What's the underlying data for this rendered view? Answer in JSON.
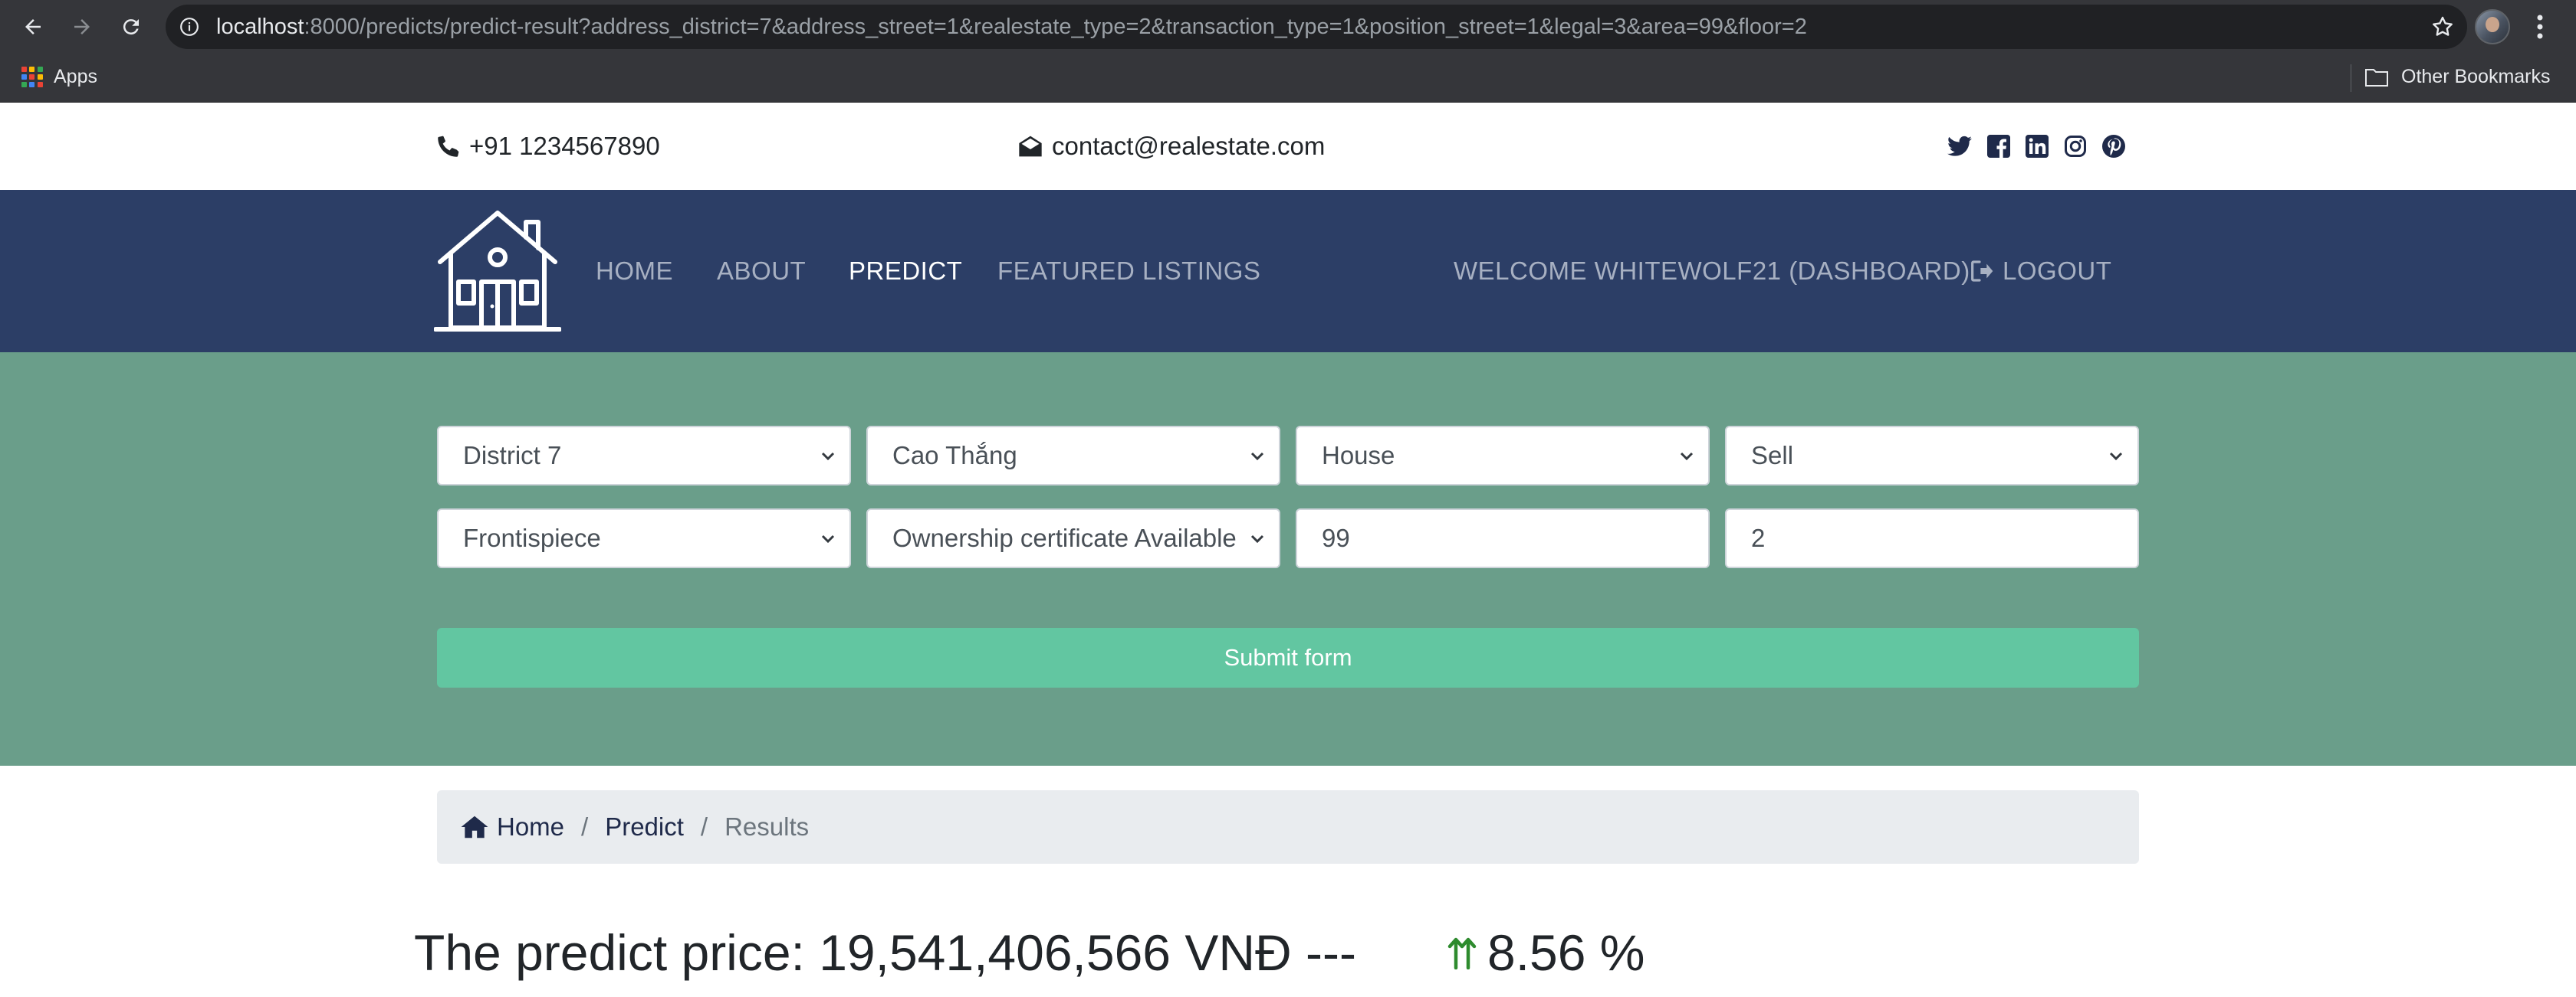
{
  "browser": {
    "url_host": "localhost",
    "url_rest": ":8000/predicts/predict-result?address_district=7&address_street=1&realestate_type=2&transaction_type=1&position_street=1&legal=3&area=99&floor=2",
    "apps_label": "Apps",
    "other_bookmarks_label": "Other Bookmarks"
  },
  "topbar": {
    "phone": "+91 1234567890",
    "email": "contact@realestate.com",
    "social_icons": [
      "twitter-icon",
      "facebook-icon",
      "linkedin-icon",
      "instagram-icon",
      "pinterest-icon"
    ]
  },
  "nav": {
    "home": "HOME",
    "about": "ABOUT",
    "predict": "PREDICT",
    "featured": "FEATURED LISTINGS",
    "welcome": "WELCOME WHITEWOLF21 (DASHBOARD)",
    "logout": "LOGOUT"
  },
  "form": {
    "district": "District 7",
    "street": "Cao Thắng",
    "realestate_type": "House",
    "transaction_type": "Sell",
    "position_street": "Frontispiece",
    "legal": "Ownership certificate Available",
    "area": "99",
    "floor": "2",
    "submit_label": "Submit form"
  },
  "breadcrumb": {
    "home": "Home",
    "predict": "Predict",
    "current": "Results",
    "separator": "/"
  },
  "result": {
    "text": "The predict price: 19,541,406,566 VNĐ ---",
    "change": "8.56 %",
    "change_direction": "up"
  },
  "colors": {
    "navbar": "#2c3e66",
    "form_bg": "#6a9e8a",
    "submit": "#62c6a1",
    "up_arrow": "#2e8b2e"
  }
}
